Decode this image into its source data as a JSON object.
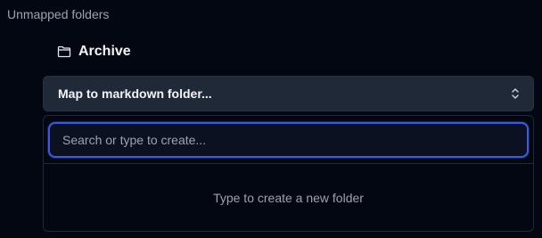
{
  "section": {
    "title": "Unmapped folders"
  },
  "folder": {
    "name": "Archive",
    "icon": "folder-icon"
  },
  "mapping_select": {
    "label": "Map to markdown folder...",
    "icon": "chevrons-up-down-icon",
    "expanded": true
  },
  "dropdown": {
    "search_placeholder": "Search or type to create...",
    "search_value": "",
    "empty_hint": "Type to create a new folder"
  },
  "colors": {
    "background": "#030712",
    "trigger_background": "#1f2937",
    "focus_ring": "#3b5bdb",
    "muted_text": "#9ca3af",
    "primary_text": "#f3f4f6"
  }
}
